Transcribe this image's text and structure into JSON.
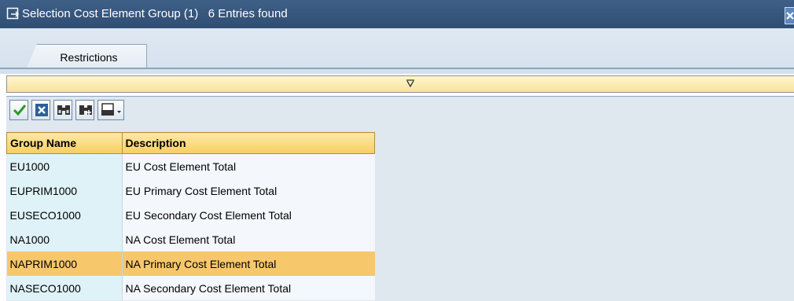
{
  "window": {
    "title": "Selection Cost Element Group (1)   6 Entries found",
    "icon": "dialog-arrow-icon",
    "close_icon": "close-icon"
  },
  "tabs": [
    {
      "label": "Restrictions",
      "active": true
    }
  ],
  "toolbar": {
    "buttons": [
      {
        "name": "confirm-button",
        "icon": "checkmark-icon",
        "color": "#2a9a2a"
      },
      {
        "name": "cancel-button",
        "icon": "cancel-x-icon",
        "color": "#2b5f9e"
      },
      {
        "name": "find-button",
        "icon": "binoculars-icon"
      },
      {
        "name": "find-next-button",
        "icon": "binoculars-plus-icon"
      },
      {
        "name": "print-button",
        "icon": "printer-dropdown-icon"
      }
    ]
  },
  "table": {
    "columns": [
      "Group Name",
      "Description"
    ],
    "rows": [
      {
        "group": "EU1000",
        "description": "EU Cost Element Total"
      },
      {
        "group": "EUPRIM1000",
        "description": "EU Primary Cost Element Total"
      },
      {
        "group": "EUSECO1000",
        "description": "EU Secondary Cost Element Total"
      },
      {
        "group": "NA1000",
        "description": "NA Cost Element Total"
      },
      {
        "group": "NAPRIM1000",
        "description": "NA Primary Cost Element Total",
        "selected": true
      },
      {
        "group": "NASECO1000",
        "description": "NA Secondary Cost Element Total"
      }
    ]
  },
  "colors": {
    "titlebar": "#3e5f86",
    "header": "#f7cf62",
    "selected_row": "#f7c76b",
    "key_column": "#dff2f7"
  }
}
